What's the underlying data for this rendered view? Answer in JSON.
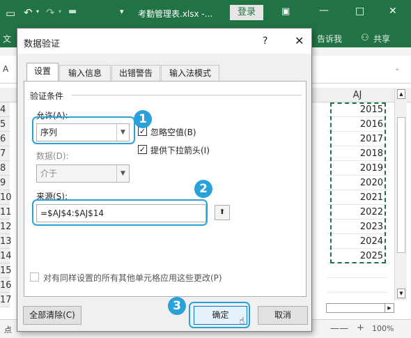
{
  "excel": {
    "file_title": "考勤管理表.xlsx -...",
    "login_label": "登录",
    "tell_me": "告诉我",
    "share": "共享",
    "column_header": "AJ",
    "rows": [
      {
        "row": "4",
        "value": "2015"
      },
      {
        "row": "5",
        "value": "2016"
      },
      {
        "row": "6",
        "value": "2017"
      },
      {
        "row": "7",
        "value": "2018"
      },
      {
        "row": "8",
        "value": "2019"
      },
      {
        "row": "9",
        "value": "2020"
      },
      {
        "row": "10",
        "value": "2021"
      },
      {
        "row": "11",
        "value": "2022"
      },
      {
        "row": "12",
        "value": "2023"
      },
      {
        "row": "13",
        "value": "2024"
      },
      {
        "row": "14",
        "value": "2025"
      },
      {
        "row": "15",
        "value": ""
      },
      {
        "row": "16",
        "value": ""
      },
      {
        "row": "17",
        "value": ""
      }
    ],
    "status_left": "点",
    "zoom": "100%",
    "name_box_letter": "A",
    "ribbon_first_letter": "文"
  },
  "dialog": {
    "title": "数据验证",
    "help_label": "?",
    "close_label": "✕",
    "tabs": [
      "设置",
      "输入信息",
      "出错警告",
      "输入法模式"
    ],
    "section_title": "验证条件",
    "allow_label": "允许(A):",
    "allow_value": "序列",
    "ignore_blank_label": "忽略空值(B)",
    "dropdown_label": "提供下拉箭头(I)",
    "data_label": "数据(D):",
    "data_value": "介于",
    "source_label": "来源(S):",
    "source_value": "=$AJ$4:$AJ$14",
    "apply_all_label": "对有同样设置的所有其他单元格应用这些更改(P)",
    "clear_all_label": "全部清除(C)",
    "ok_label": "确定",
    "cancel_label": "取消"
  },
  "annotations": [
    "1",
    "2",
    "3"
  ],
  "colors": {
    "excel_green": "#217346",
    "callout_blue": "#2aa1d8",
    "cell_border": "#217346"
  }
}
